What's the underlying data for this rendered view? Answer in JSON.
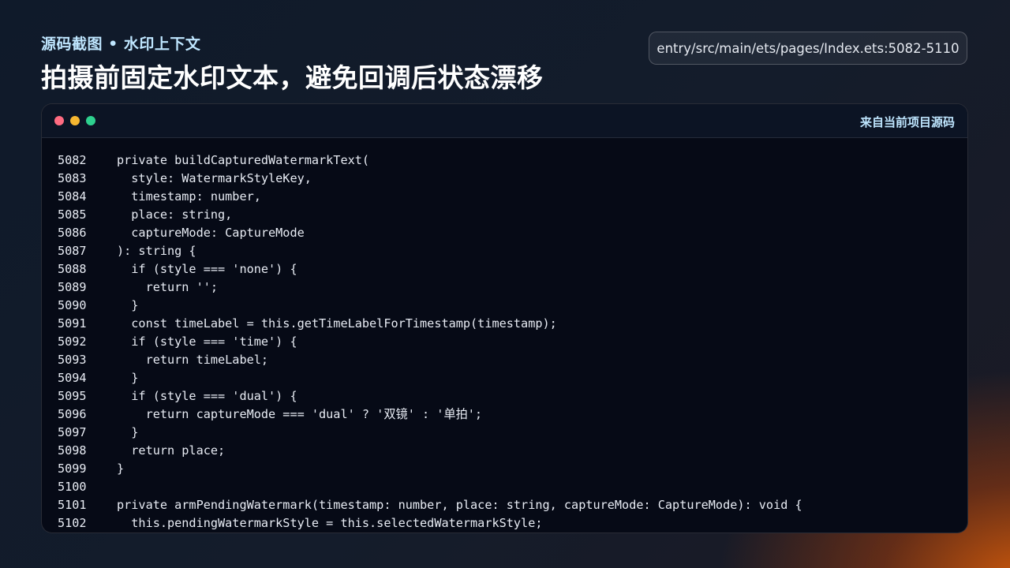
{
  "header": {
    "kicker": "源码截图 • 水印上下文",
    "title": "拍摄前固定水印文本，避免回调后状态漂移",
    "file_path": "entry/src/main/ets/pages/Index.ets:5082-5110"
  },
  "code_window": {
    "source_label": "来自当前项目源码",
    "dots": [
      "red",
      "yellow",
      "green"
    ],
    "lines": [
      {
        "num": "5082",
        "text": "private buildCapturedWatermarkText("
      },
      {
        "num": "5083",
        "text": "  style: WatermarkStyleKey,"
      },
      {
        "num": "5084",
        "text": "  timestamp: number,"
      },
      {
        "num": "5085",
        "text": "  place: string,"
      },
      {
        "num": "5086",
        "text": "  captureMode: CaptureMode"
      },
      {
        "num": "5087",
        "text": "): string {"
      },
      {
        "num": "5088",
        "text": "  if (style === 'none') {"
      },
      {
        "num": "5089",
        "text": "    return '';"
      },
      {
        "num": "5090",
        "text": "  }"
      },
      {
        "num": "5091",
        "text": "  const timeLabel = this.getTimeLabelForTimestamp(timestamp);"
      },
      {
        "num": "5092",
        "text": "  if (style === 'time') {"
      },
      {
        "num": "5093",
        "text": "    return timeLabel;"
      },
      {
        "num": "5094",
        "text": "  }"
      },
      {
        "num": "5095",
        "text": "  if (style === 'dual') {"
      },
      {
        "num": "5096",
        "text": "    return captureMode === 'dual' ? '双镜' : '单拍';"
      },
      {
        "num": "5097",
        "text": "  }"
      },
      {
        "num": "5098",
        "text": "  return place;"
      },
      {
        "num": "5099",
        "text": "}"
      },
      {
        "num": "5100",
        "text": ""
      },
      {
        "num": "5101",
        "text": "private armPendingWatermark(timestamp: number, place: string, captureMode: CaptureMode): void {"
      },
      {
        "num": "5102",
        "text": "  this.pendingWatermarkStyle = this.selectedWatermarkStyle;"
      }
    ]
  }
}
